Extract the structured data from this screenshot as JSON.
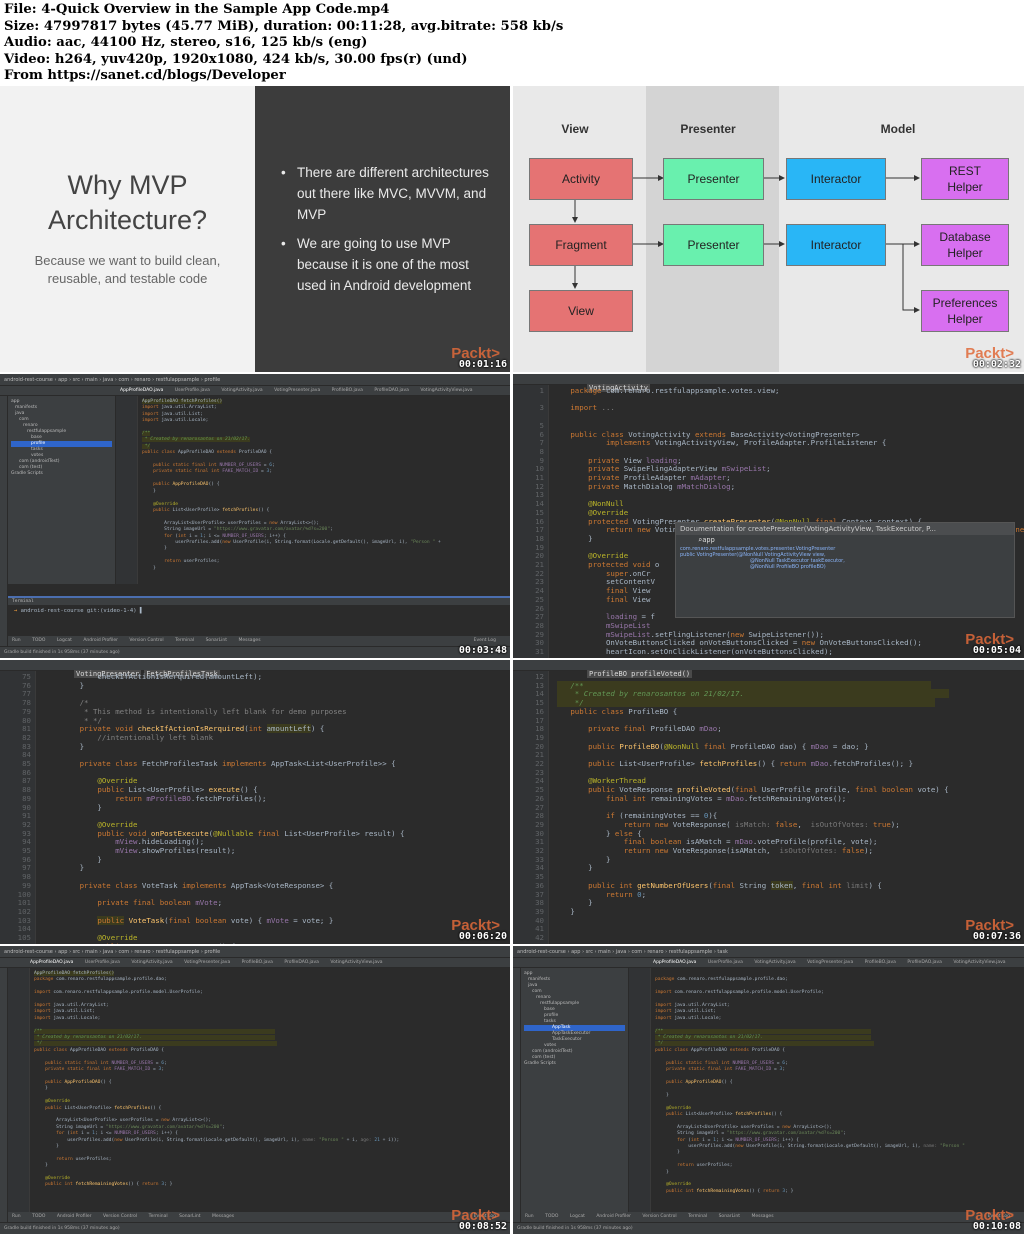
{
  "info": {
    "file": "File: 4-Quick Overview in the Sample App Code.mp4",
    "size": "Size: 47997817 bytes (45.77 MiB), duration: 00:11:28, avg.bitrate: 558 kb/s",
    "audio": "Audio: aac, 44100 Hz, stereo, s16, 125 kb/s (eng)",
    "video": "Video: h264, yuv420p, 1920x1080, 424 kb/s, 30.00 fps(r) (und)",
    "from": "From https://sanet.cd/blogs/Developer"
  },
  "brand": "Packt>",
  "frame1": {
    "title": "Why MVP Architecture?",
    "subtitle": "Because we want to build clean, reusable, and testable code",
    "bullets": [
      "There are different architectures out there like MVC, MVVM, and MVP",
      "We are going to use MVP because it is one of the most used in Android development"
    ],
    "timestamp": "00:01:16"
  },
  "frame2": {
    "col_view": "View",
    "col_presenter": "Presenter",
    "col_model": "Model",
    "activity": "Activity",
    "fragment": "Fragment",
    "view": "View",
    "presenter1": "Presenter",
    "presenter2": "Presenter",
    "interactor1": "Interactor",
    "interactor2": "Interactor",
    "rest_helper": "REST Helper",
    "db_helper": "Database Helper",
    "prefs_helper": "Preferences Helper",
    "timestamp": "00:02:32",
    "colors": {
      "view_box": "#e57373",
      "presenter_box": "#69f0ae",
      "interactor_box": "#29b6f6",
      "model_box": "#d86ff0"
    }
  },
  "frame3": {
    "project": "android-rest-course",
    "tabs": [
      "AppProfileDAO.java",
      "UserProfile.java",
      "VotingActivity.java",
      "VotingPresenter.java",
      "ProfileBO.java",
      "ProfileDAO.java",
      "VotingActivityView.java"
    ],
    "tree": [
      "app",
      "manifests",
      "java",
      "com",
      "renaro",
      "restfulappsample",
      "base",
      "profile",
      "tasks",
      "votes",
      "com (androidTest)",
      "com (test)",
      "Gradle Scripts"
    ],
    "crumb": "AppProfileDAO fetchProfiles()",
    "terminal_label": "Terminal",
    "terminal_cmd": "android-rest-course git:(video-1-4)",
    "bottom_tools": [
      "Run",
      "TODO",
      "Logcat",
      "Android Profiler",
      "Version Control",
      "Terminal",
      "SonarLint",
      "Messages"
    ],
    "event_log": "Event Log",
    "status": "Gradle build finished in 1s 958ms (37 minutes ago)",
    "timestamp": "00:03:48"
  },
  "frame4": {
    "crumb": "VotingActivity",
    "popup_title": "Documentation for createPresenter(VotingActivityView, TaskExecutor, P...",
    "popup_input": "app",
    "popup_lines": [
      "com.renaro.restfulappsample.votes.presenter.VotingPresenter",
      "public VotingPresenter(@NonNull VotingActivityView view,",
      "@NonNull TaskExecutor taskExecutor,",
      "@NonNull ProfileBO profileBO)"
    ],
    "timestamp": "00:05:04"
  },
  "frame5": {
    "crumb1": "VotingPresenter",
    "crumb2": "FetchProfilesTask",
    "timestamp": "00:06:20"
  },
  "frame6": {
    "crumb": "ProfileBO profileVoted()",
    "timestamp": "00:07:36"
  },
  "frame7": {
    "crumb": "AppProfileDAO fetchProfiles()",
    "timestamp": "00:08:52"
  },
  "frame8": {
    "tree_sel": "AppTask",
    "tree_extra": [
      "AppTaskExecutor",
      "TaskExecutor"
    ],
    "timestamp": "00:10:08"
  }
}
